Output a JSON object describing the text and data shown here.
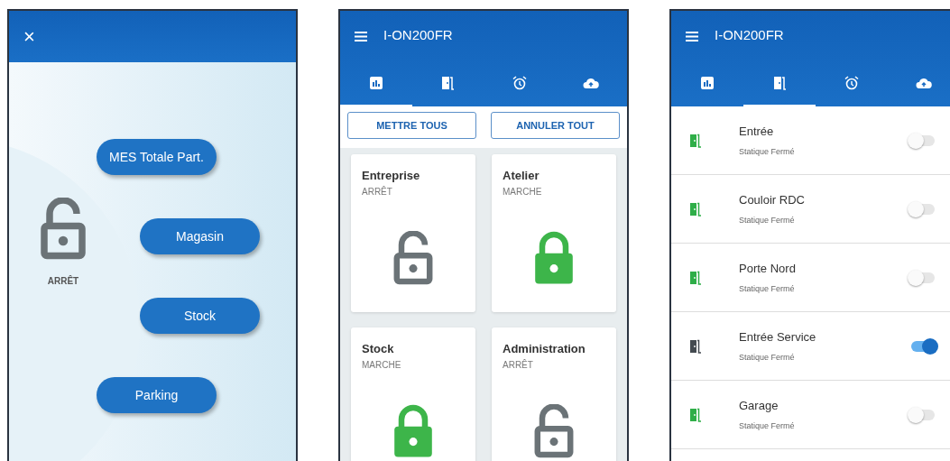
{
  "screens": [
    {
      "kind": "zones",
      "close": "×",
      "lock": {
        "locked": false,
        "label": "ARRÊT"
      },
      "zones": [
        "MES Totale Part.",
        "Magasin",
        "Stock",
        "Parking"
      ]
    },
    {
      "kind": "groups",
      "title": "I-ON200FR",
      "tabs": [
        {
          "kind": "chart",
          "selected": true
        },
        {
          "kind": "door",
          "selected": false
        },
        {
          "kind": "alarm",
          "selected": false
        },
        {
          "kind": "upload",
          "selected": false
        }
      ],
      "buttons": [
        "METTRE TOUS",
        "ANNULER TOUT"
      ],
      "groups": [
        {
          "name": "Entreprise",
          "status": "ARRÊT",
          "locked": false
        },
        {
          "name": "Atelier",
          "status": "MARCHE",
          "locked": true
        },
        {
          "name": "Stock",
          "status": "MARCHE",
          "locked": true
        },
        {
          "name": "Administration",
          "status": "ARRÊT",
          "locked": false
        }
      ]
    },
    {
      "kind": "doors",
      "title": "I-ON200FR",
      "tabs": [
        {
          "kind": "chart",
          "selected": false
        },
        {
          "kind": "door",
          "selected": true
        },
        {
          "kind": "alarm",
          "selected": false
        },
        {
          "kind": "upload",
          "selected": false
        }
      ],
      "doors": [
        {
          "name": "Entrée",
          "status": "Statique Fermé",
          "on": false
        },
        {
          "name": "Couloir RDC",
          "status": "Statique Fermé",
          "on": false
        },
        {
          "name": "Porte Nord",
          "status": "Statique Fermé",
          "on": false
        },
        {
          "name": "Entrée Service",
          "status": "Statique Fermé",
          "on": true
        },
        {
          "name": "Garage",
          "status": "Statique Fermé",
          "on": false
        }
      ]
    }
  ]
}
